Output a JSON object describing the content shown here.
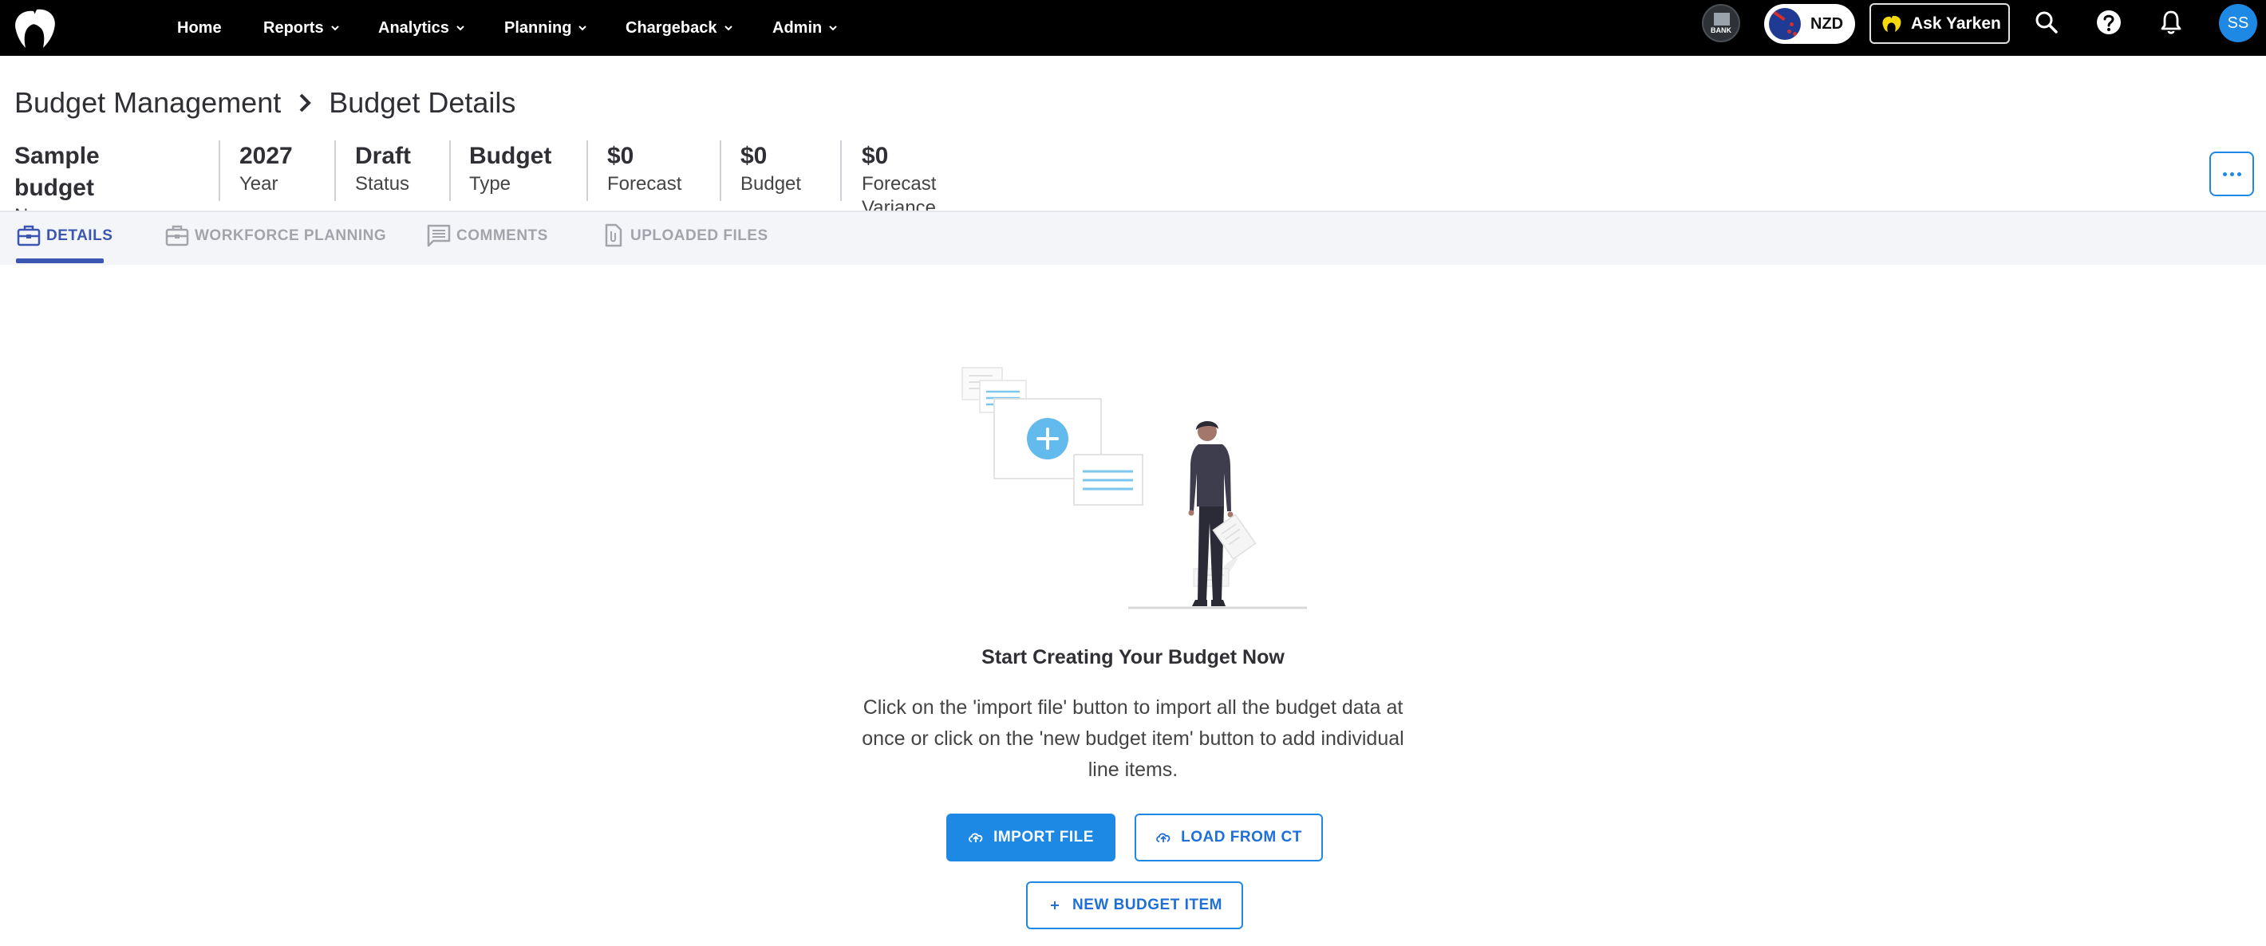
{
  "nav": {
    "items": [
      {
        "label": "Home",
        "has_menu": false
      },
      {
        "label": "Reports",
        "has_menu": true
      },
      {
        "label": "Analytics",
        "has_menu": true
      },
      {
        "label": "Planning",
        "has_menu": true
      },
      {
        "label": "Chargeback",
        "has_menu": true
      },
      {
        "label": "Admin",
        "has_menu": true
      }
    ],
    "bank_label": "BANK",
    "currency": "NZD",
    "ask_label": "Ask Yarken",
    "avatar_initials": "SS"
  },
  "breadcrumb": {
    "parent": "Budget Management",
    "current": "Budget Details"
  },
  "summary": [
    {
      "value": "Sample budget",
      "label": "Name"
    },
    {
      "value": "2027",
      "label": "Year"
    },
    {
      "value": "Draft",
      "label": "Status"
    },
    {
      "value": "Budget",
      "label": "Type"
    },
    {
      "value": "$0",
      "label": "Forecast"
    },
    {
      "value": "$0",
      "label": "Budget"
    },
    {
      "value": "$0",
      "label": "Forecast Variance"
    }
  ],
  "tabs": [
    {
      "label": "DETAILS",
      "icon": "briefcase-icon",
      "active": true
    },
    {
      "label": "WORKFORCE PLANNING",
      "icon": "briefcase-icon",
      "active": false
    },
    {
      "label": "COMMENTS",
      "icon": "comment-icon",
      "active": false
    },
    {
      "label": "UPLOADED FILES",
      "icon": "file-icon",
      "active": false
    }
  ],
  "empty_state": {
    "title": "Start Creating Your Budget Now",
    "description": "Click on the 'import file' button to import all the budget data at once or click on the 'new budget item' button to add individual line items.",
    "import_label": "IMPORT FILE",
    "load_label": "LOAD FROM CT",
    "new_item_label": "NEW BUDGET ITEM"
  },
  "colors": {
    "nav_bg": "#000000",
    "accent": "#1e88e5",
    "active_tab": "#3a56b0",
    "tab_bar_bg": "#f4f5f9"
  }
}
